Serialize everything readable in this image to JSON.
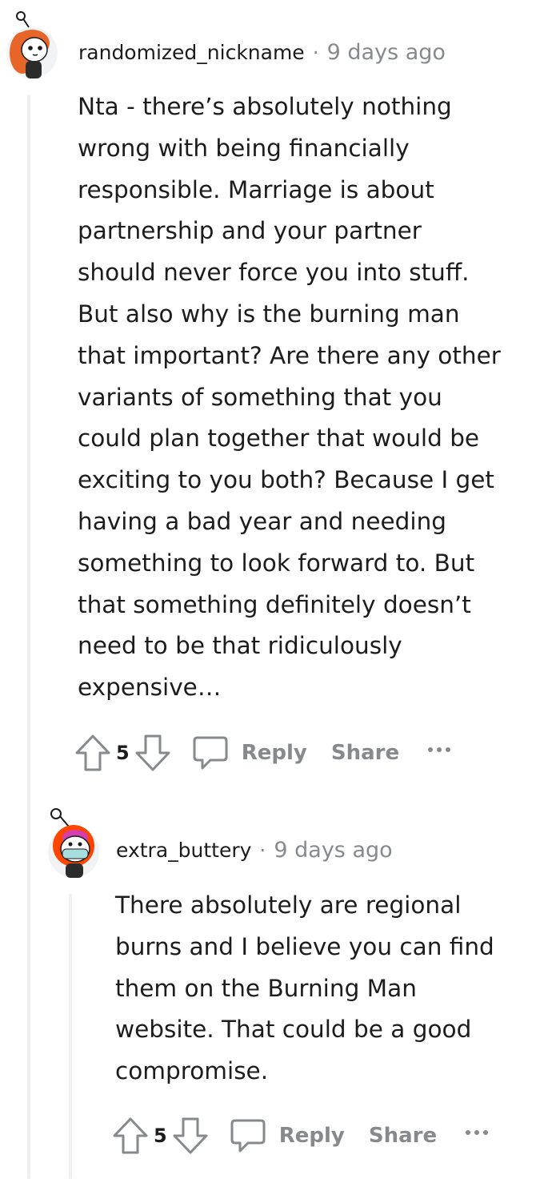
{
  "comments": [
    {
      "username": "randomized_nickname",
      "separator": "·",
      "timestamp": "9 days ago",
      "avatar_icon": "snoo-avatar-orange-hair-icon",
      "body_lines": [
        "Nta - there’s absolutely nothing",
        "wrong with being financially",
        "responsible. Marriage is about",
        "partnership and your partner",
        "should never force you into stuff.",
        "But also why is the burning man",
        "that important? Are there any other",
        "variants of something that you",
        "could plan together that would be",
        "exciting to you both? Because I get",
        "having a bad year and needing",
        "something to look forward to. But",
        "that something definitely doesn’t",
        "need to be that ridiculously",
        "expensive…"
      ],
      "votes": "5",
      "reply_label": "Reply",
      "share_label": "Share"
    },
    {
      "username": "extra_buttery",
      "separator": "·",
      "timestamp": "9 days ago",
      "avatar_icon": "snoo-avatar-orange-hood-mask-icon",
      "body_lines": [
        "There absolutely are regional",
        "burns and I believe you can find",
        "them on the Burning Man",
        "website. That could be a good",
        "compromise."
      ],
      "votes": "5",
      "reply_label": "Reply",
      "share_label": "Share"
    }
  ],
  "colors": {
    "text": "#1c1c1c",
    "meta": "#878a8c",
    "thread_line": "#edeff1",
    "avatar_orange": "#ff4500"
  }
}
